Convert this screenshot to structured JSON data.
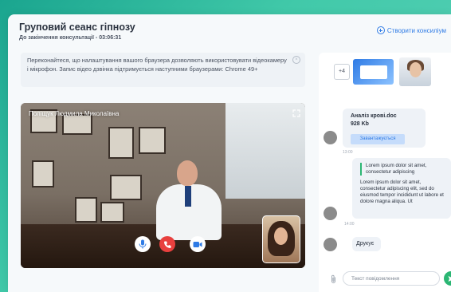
{
  "header": {
    "title": "Груповий сеанс гіпнозу",
    "subtitle": "До закінчення консультації - 03:06:31",
    "create_label": "Створити консиліум"
  },
  "notice": {
    "text": "Переконайтеся, що налаштування вашого браузера дозволяють використовувати відеокамеру і мікрофон. Запис відео дзвінка підтримується наступними браузерами: Chrome 49+"
  },
  "video": {
    "participant_name": "Поліщук Людмила Миколаївна"
  },
  "chat": {
    "thumbnails_more": "+4",
    "file": {
      "name": "Аналіз крові.doc",
      "size": "928 Kb",
      "status": "Завантажується",
      "time": "13:00"
    },
    "message": {
      "quote": "Lorem ipsum dolor sit amet, consectetur adipiscing",
      "body": "Lorem ipsum dolor sit amet, consectetur adipiscing elit, sed do eiusmod tempor incididunt ut labore et dolore magna aliqua. Ut",
      "time": "14:00"
    },
    "typing": "Друкує",
    "input_placeholder": "Текст повідомлення"
  },
  "colors": {
    "accent_blue": "#2f7be5",
    "end_call_red": "#e8403e",
    "send_green": "#2bb673"
  }
}
